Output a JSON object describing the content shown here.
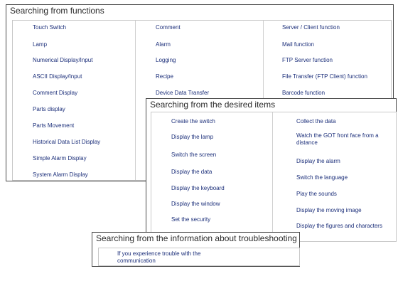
{
  "functions": {
    "title": "Searching from functions",
    "col1": [
      "Touch Switch",
      "Lamp",
      "Numerical Display/Input",
      "ASCII Display/Input",
      "Comment Display",
      "Parts display",
      "Parts Movement",
      "Historical Data List Display",
      "Simple Alarm Display",
      "System Alarm Display"
    ],
    "col2": [
      "Comment",
      "Alarm",
      "Logging",
      "Recipe",
      "Device Data Transfer"
    ],
    "col3": [
      "Server / Client function",
      "Mail function",
      "FTP Server function",
      "File Transfer (FTP Client) function",
      "Barcode function"
    ]
  },
  "desired": {
    "title": "Searching from the desired items",
    "col1": [
      "Create the switch",
      "Display the lamp",
      "Switch the screen",
      "Display the data",
      "Display the keyboard",
      "Display the window",
      "Set the security"
    ],
    "col2": [
      "Collect the data",
      "Watch the GOT front face from a distance",
      "Display the alarm",
      "Switch the language",
      "Play the sounds",
      "Display the moving image",
      "Display the figures and characters"
    ]
  },
  "trouble": {
    "title": "Searching from the information about troubleshooting",
    "item": "If you experience trouble with the communication"
  }
}
